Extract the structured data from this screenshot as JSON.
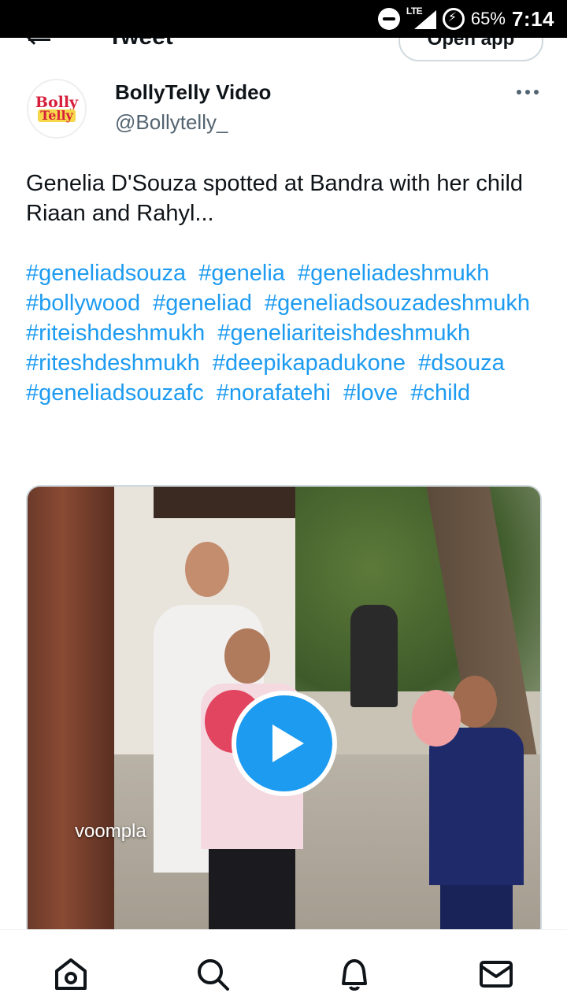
{
  "status_bar": {
    "network": "LTE",
    "battery": "65%",
    "time": "7:14"
  },
  "header": {
    "title": "Tweet",
    "open_app_label": "Open app"
  },
  "tweet": {
    "author_name": "BollyTelly Video",
    "author_handle": "@Bollytelly_",
    "avatar_text_line1": "Bolly",
    "avatar_text_line2": "Telly",
    "text": "Genelia D'Souza spotted at Bandra with her child Riaan and Rahyl...",
    "hashtags": [
      "#geneliadsouza",
      "#genelia",
      "#geneliadeshmukh",
      "#bollywood",
      "#geneliad",
      "#geneliadsouzadeshmukh",
      "#riteishdeshmukh",
      "#geneliariteishdeshmukh",
      "#riteshdeshmukh",
      "#deepikapadukone",
      "#dsouza",
      "#geneliadsouzafc",
      "#norafatehi",
      "#love",
      "#child"
    ],
    "video": {
      "watermark": "voompla"
    }
  },
  "colors": {
    "accent": "#1d9bf0",
    "text": "#0f1419",
    "secondary_text": "#536471",
    "border": "#cfd9de"
  },
  "bottom_nav": [
    {
      "name": "home",
      "icon": "home-icon"
    },
    {
      "name": "search",
      "icon": "search-icon"
    },
    {
      "name": "notifications",
      "icon": "bell-icon"
    },
    {
      "name": "messages",
      "icon": "envelope-icon"
    }
  ]
}
